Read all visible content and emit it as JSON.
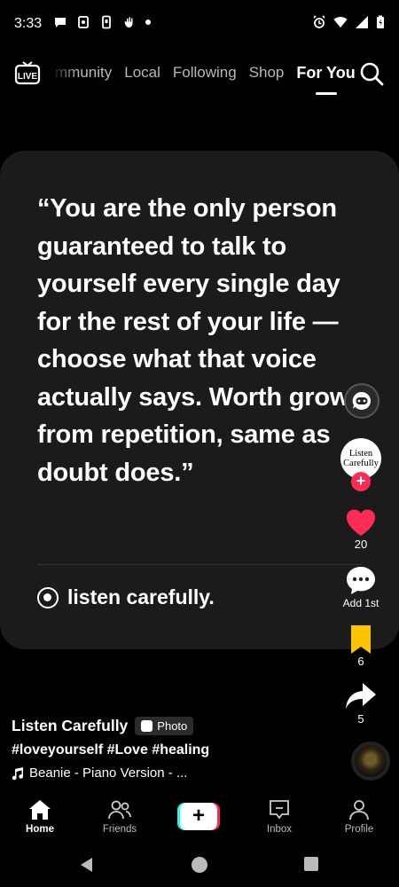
{
  "status_bar": {
    "time": "3:33",
    "left_icons": [
      "chat-bubble-icon",
      "clipboard-icon",
      "phone-icon",
      "hand-icon",
      "dot-icon"
    ],
    "right_icons": [
      "alarm-icon",
      "wifi-icon",
      "signal-icon",
      "battery-icon"
    ]
  },
  "top_nav": {
    "live_label": "LIVE",
    "tabs": [
      {
        "label": "mmunity"
      },
      {
        "label": "Local"
      },
      {
        "label": "Following"
      },
      {
        "label": "Shop"
      },
      {
        "label": "For You",
        "active": true
      }
    ]
  },
  "post": {
    "quote": "“You are the only person guaranteed to talk to yourself every single day for the rest of your life — choose what that voice actually says. Worth grows from repetition, same as doubt does.”",
    "brand": "listen carefully."
  },
  "rail": {
    "avatar_text": "Listen Carefully",
    "likes": "20",
    "comments_label": "Add 1st",
    "saves": "6",
    "shares": "5"
  },
  "caption": {
    "title": "Listen Carefully",
    "badge": "Photo",
    "hashtags": "#loveyourself #Love #healing",
    "music": "Beanie - Piano Version - ..."
  },
  "bottom_nav": {
    "home": "Home",
    "friends": "Friends",
    "create": "+",
    "inbox": "Inbox",
    "profile": "Profile"
  },
  "colors": {
    "background": "#000000",
    "card": "#1b1b1b",
    "like_red": "#fe2c55",
    "save_yellow": "#fcc400",
    "accent_cyan": "#25f4ee"
  }
}
